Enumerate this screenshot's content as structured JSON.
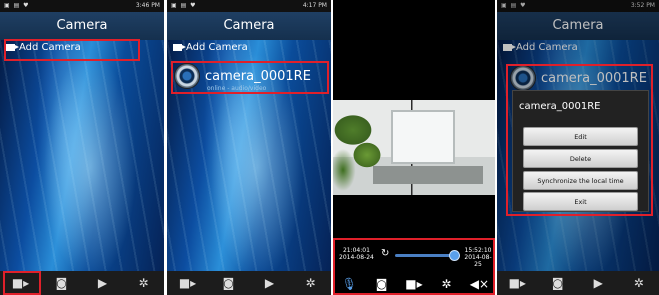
{
  "phones": [
    {
      "status": {
        "left": "▣ ▤ ♥",
        "right": "3:46 PM"
      },
      "title": "Camera",
      "add_camera_label": "Add Camera"
    },
    {
      "status": {
        "left": "▣ ▤ ♥",
        "right": "4:17 PM"
      },
      "title": "Camera",
      "add_camera_label": "Add Camera",
      "camera": {
        "name": "camera_0001RE",
        "status": "online - audio/video"
      }
    },
    {
      "playback": {
        "start_time": "21:04:01",
        "start_date": "2014-08-24",
        "end_time": "15:52:10",
        "end_date": "2014-08-25"
      }
    },
    {
      "status": {
        "left": "▣ ▤ ♥",
        "right": "3:52 PM"
      },
      "title": "Camera",
      "add_camera_label": "Add Camera",
      "camera": {
        "name": "camera_0001RE"
      },
      "menu": {
        "title": "camera_0001RE",
        "items": [
          "Edit",
          "Delete",
          "Synchronize the local time",
          "Exit"
        ]
      }
    }
  ],
  "bottom_nav_icons": [
    "video-camera-icon",
    "camera-icon",
    "play-icon",
    "gear-icon"
  ],
  "playback_icons": [
    "microphone-icon",
    "camera-icon",
    "video-camera-icon",
    "gear-icon",
    "speaker-icon"
  ],
  "colors": {
    "highlight": "#e0202a",
    "title_bar": "#1f3f63",
    "accent": "#5aa0ea"
  }
}
